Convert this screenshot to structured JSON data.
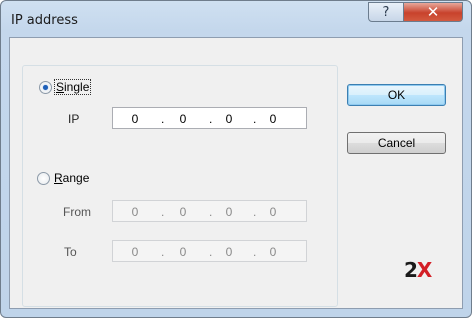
{
  "window": {
    "title": "IP address",
    "help_glyph": "?",
    "close_glyph": "✕"
  },
  "single": {
    "label": "Single",
    "selected": true,
    "ip_label": "IP",
    "ip_octets": [
      "0",
      "0",
      "0",
      "0"
    ]
  },
  "range": {
    "label": "Range",
    "selected": false,
    "from_label": "From",
    "from_octets": [
      "0",
      "0",
      "0",
      "0"
    ],
    "to_label": "To",
    "to_octets": [
      "0",
      "0",
      "0",
      "0"
    ]
  },
  "separator": ".",
  "buttons": {
    "ok": "OK",
    "cancel": "Cancel"
  },
  "logo": {
    "text": "2X",
    "two": "2",
    "x": "X",
    "accent": "#d31f26"
  }
}
